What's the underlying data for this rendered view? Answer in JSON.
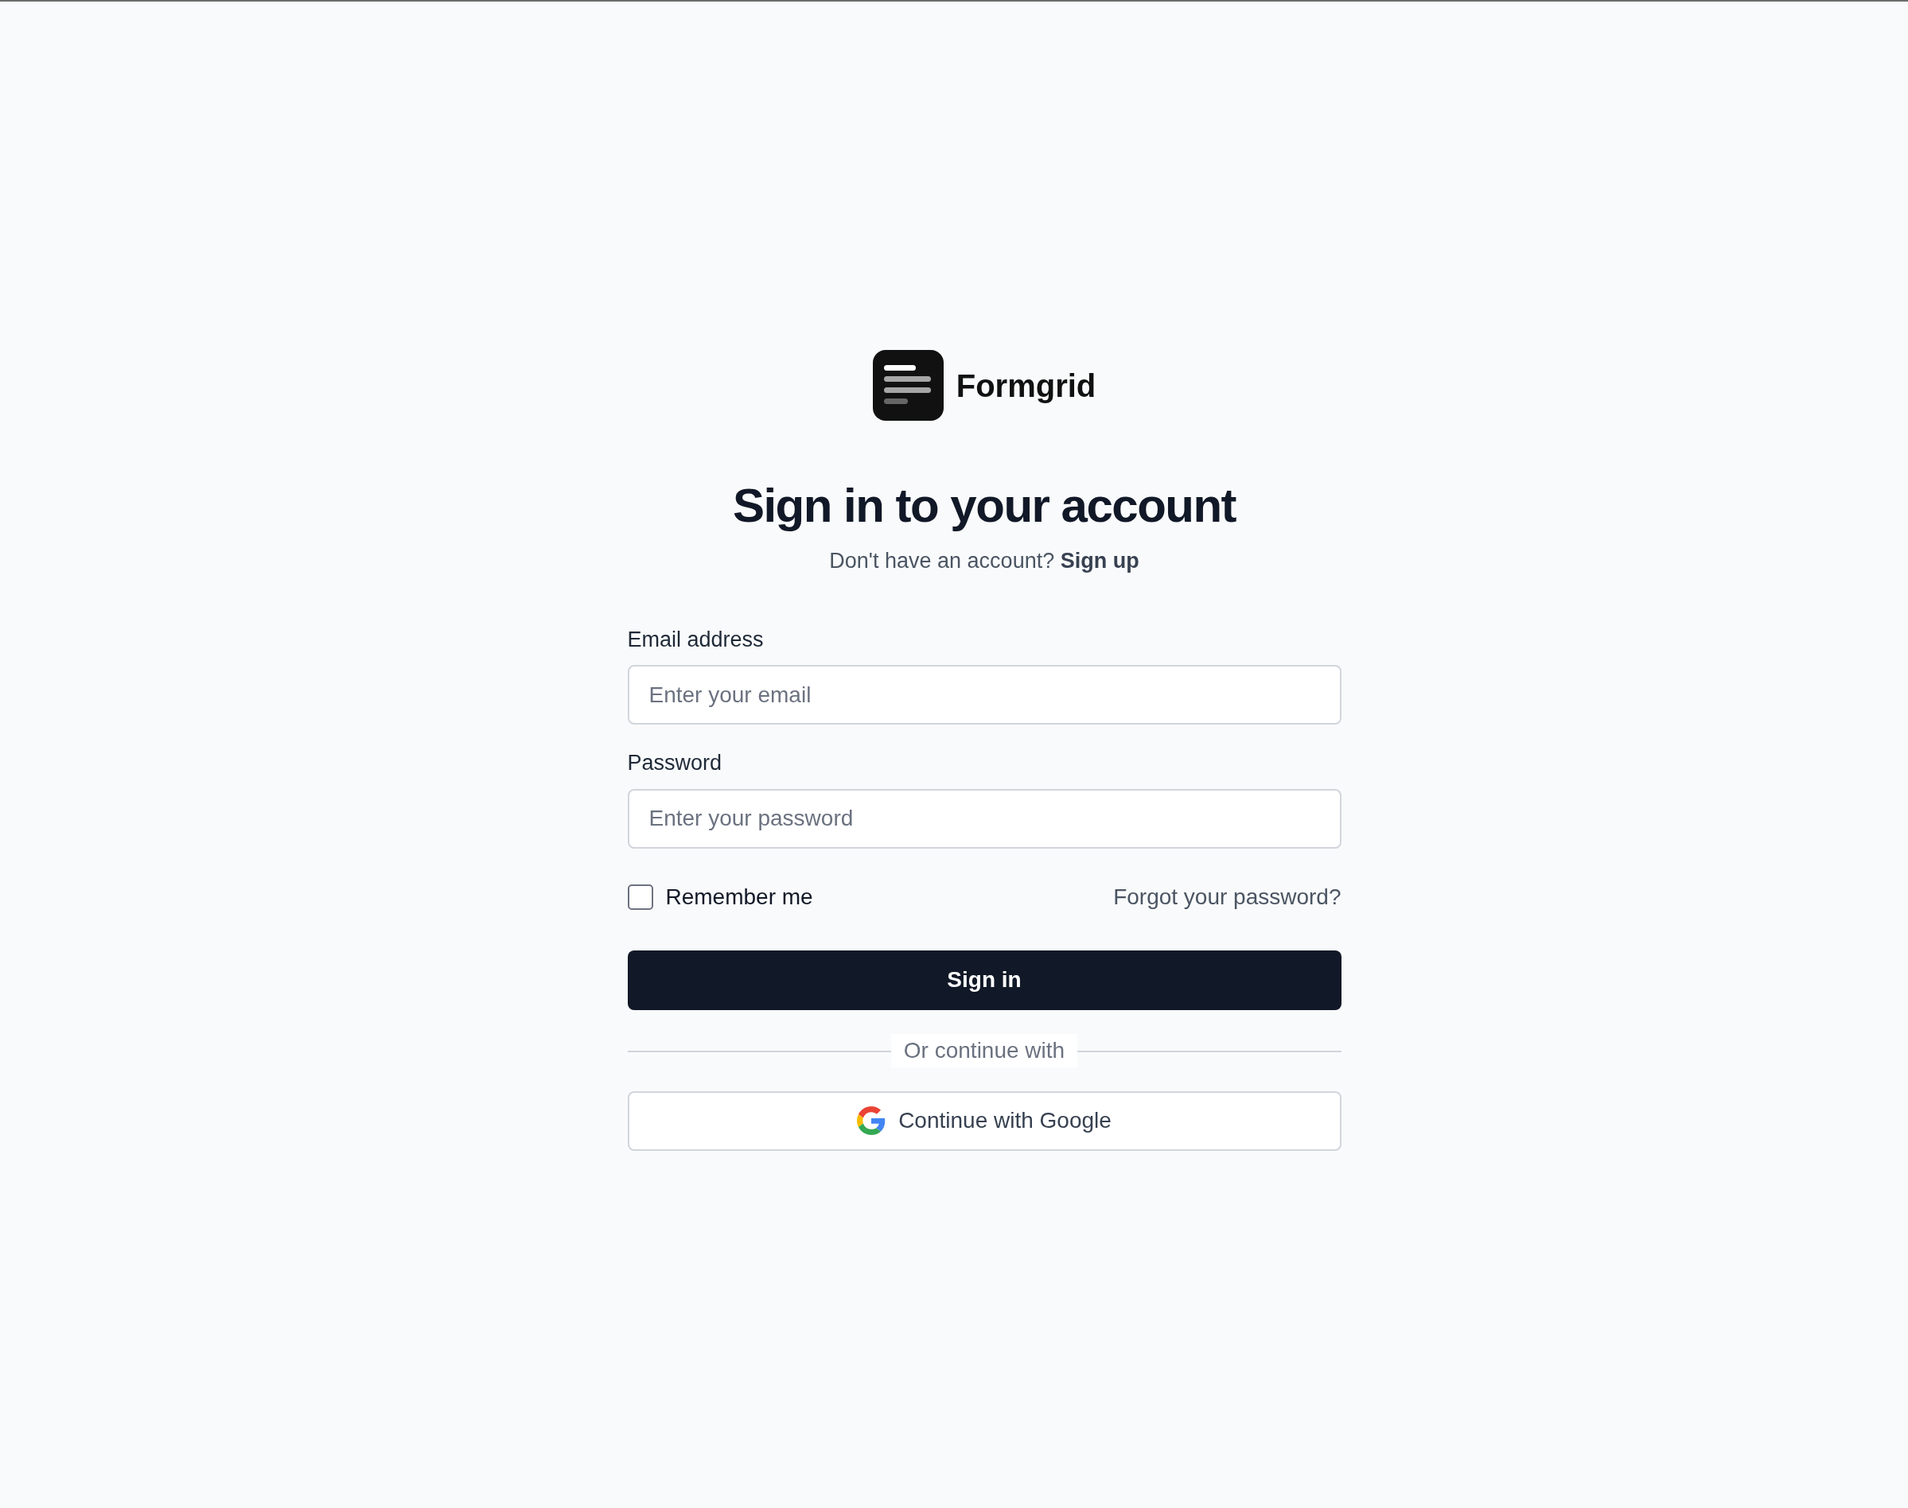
{
  "brand": {
    "name": "Formgrid"
  },
  "heading": "Sign in to your account",
  "signup_prompt": {
    "text": "Don't have an account?",
    "link": "Sign up"
  },
  "fields": [
    {
      "label": "Email address",
      "placeholder": "Enter your email"
    },
    {
      "label": "Password",
      "placeholder": "Enter your password"
    }
  ],
  "remember_me": {
    "label": "Remember me",
    "checked": false
  },
  "forgot_link": "Forgot your password?",
  "submit_button": "Sign in",
  "divider": "Or continue with",
  "google_button": "Continue with Google"
}
